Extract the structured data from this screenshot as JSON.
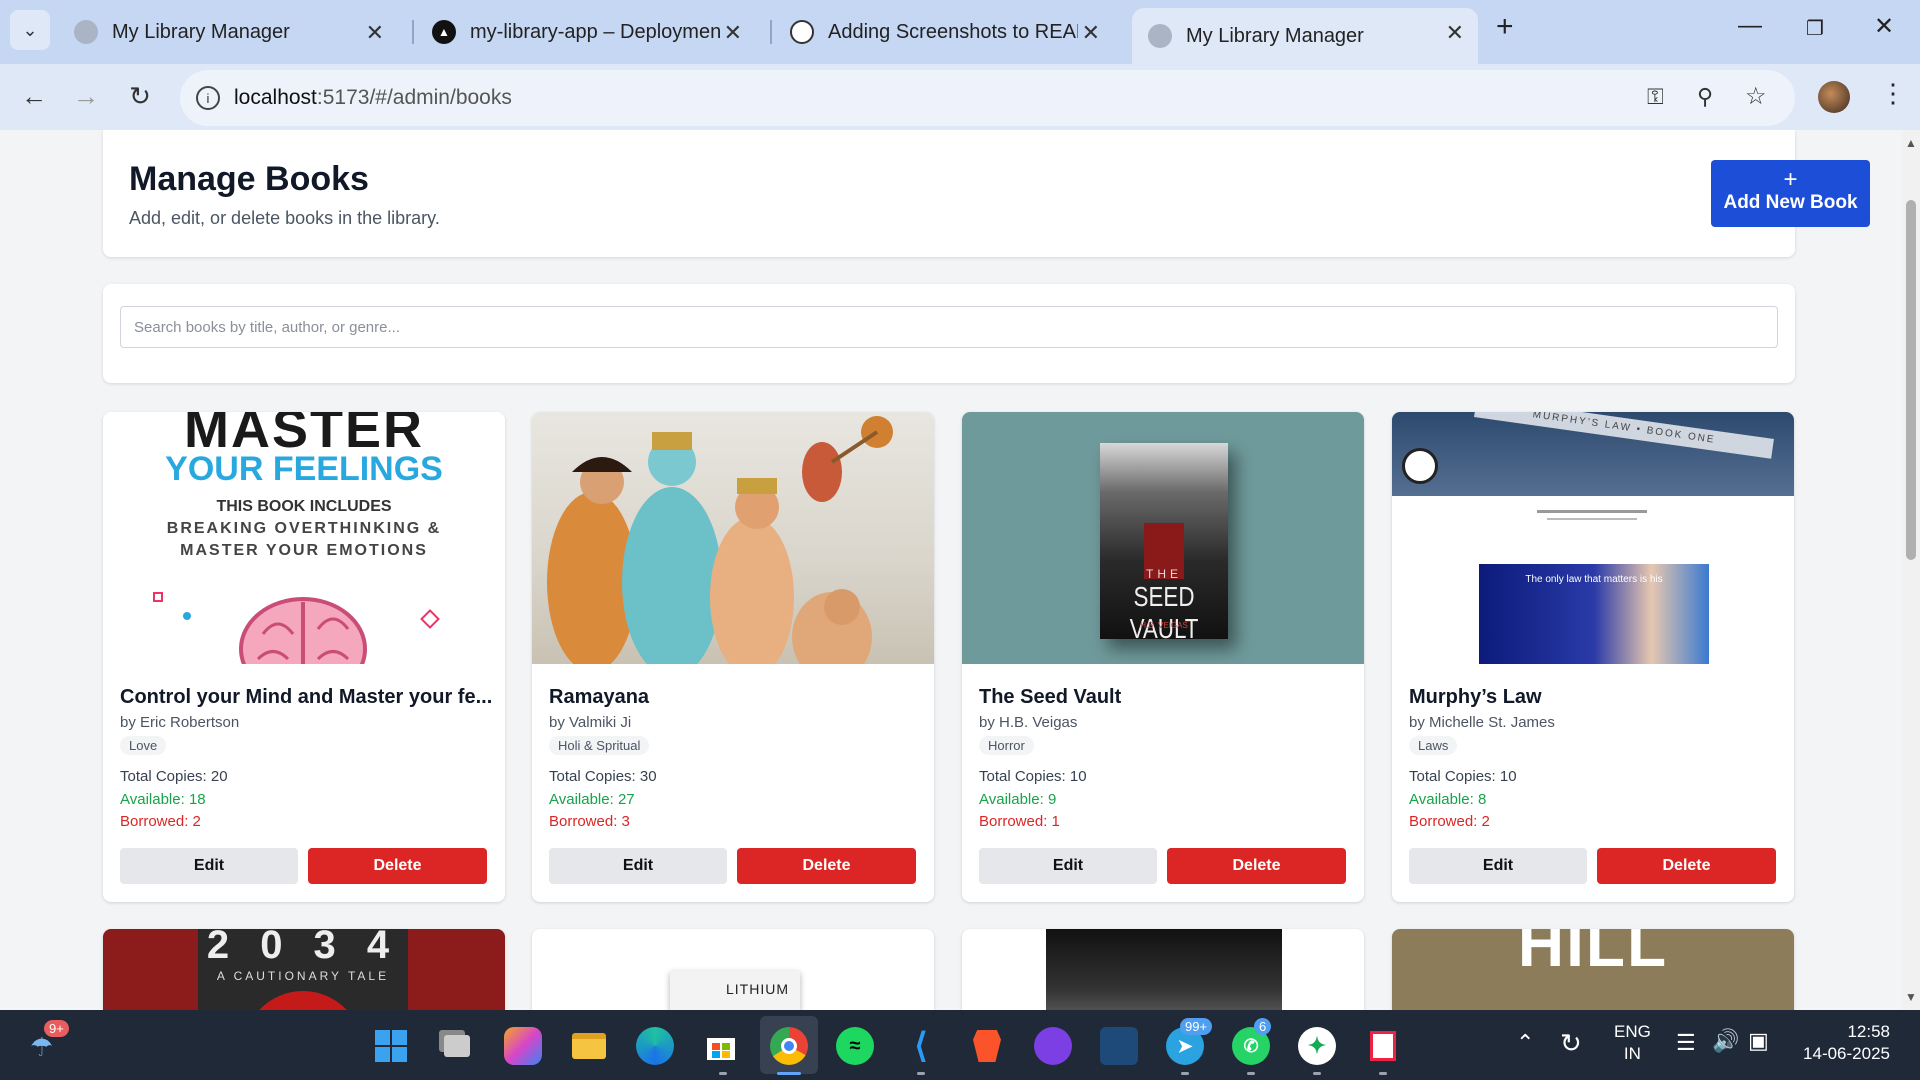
{
  "tabs": [
    {
      "title": "My Library Manager"
    },
    {
      "title": "my-library-app – Deployment O"
    },
    {
      "title": "Adding Screenshots to README"
    },
    {
      "title": "My Library Manager"
    }
  ],
  "address": {
    "host": "localhost",
    "path": ":5173/#/admin/books"
  },
  "header": {
    "title": "Manage Books",
    "subtitle": "Add, edit, or delete books in the library.",
    "add_button": "Add New Book",
    "add_icon": "+"
  },
  "search": {
    "placeholder": "Search books by title, author, or genre..."
  },
  "labels": {
    "total": "Total Copies:",
    "available": "Available:",
    "borrowed": "Borrowed:",
    "edit": "Edit",
    "delete": "Delete"
  },
  "books": [
    {
      "title": "Control your Mind and Master your fe...",
      "author": "by Eric Robertson",
      "genre": "Love",
      "total": "20",
      "available": "18",
      "borrowed": "2",
      "cover_text": [
        "MASTER",
        "YOUR FEELINGS",
        "THIS BOOK INCLUDES",
        "BREAKING OVERTHINKING &",
        "MASTER YOUR EMOTIONS"
      ]
    },
    {
      "title": "Ramayana",
      "author": "by Valmiki Ji",
      "genre": "Holi & Spritual",
      "total": "30",
      "available": "27",
      "borrowed": "3"
    },
    {
      "title": "The Seed Vault",
      "author": "by H.B. Veigas",
      "genre": "Horror",
      "total": "10",
      "available": "9",
      "borrowed": "1",
      "cover_text": [
        "THE",
        "SEED VAULT",
        "H.B. VEIGAS"
      ]
    },
    {
      "title": "Murphy’s Law",
      "author": "by Michelle St. James",
      "genre": "Laws",
      "total": "10",
      "available": "8",
      "borrowed": "2",
      "cover_text": [
        "MURPHY'S LAW • BOOK ONE",
        "The only law that matters is his"
      ]
    }
  ],
  "partial_covers": [
    "2 0 3 4",
    "A CAUTIONARY TALE",
    "LITHIUM",
    "HILL"
  ],
  "taskbar": {
    "notif_badge": "9+",
    "telegram_badge": "99+",
    "whatsapp_badge": "6",
    "lang": "ENG",
    "region": "IN",
    "time": "12:58",
    "date": "14-06-2025"
  },
  "colors": {
    "accent": "#1d4ed8",
    "danger": "#dc2626",
    "success": "#16a34a",
    "tabbar": "#c5d7f2"
  }
}
